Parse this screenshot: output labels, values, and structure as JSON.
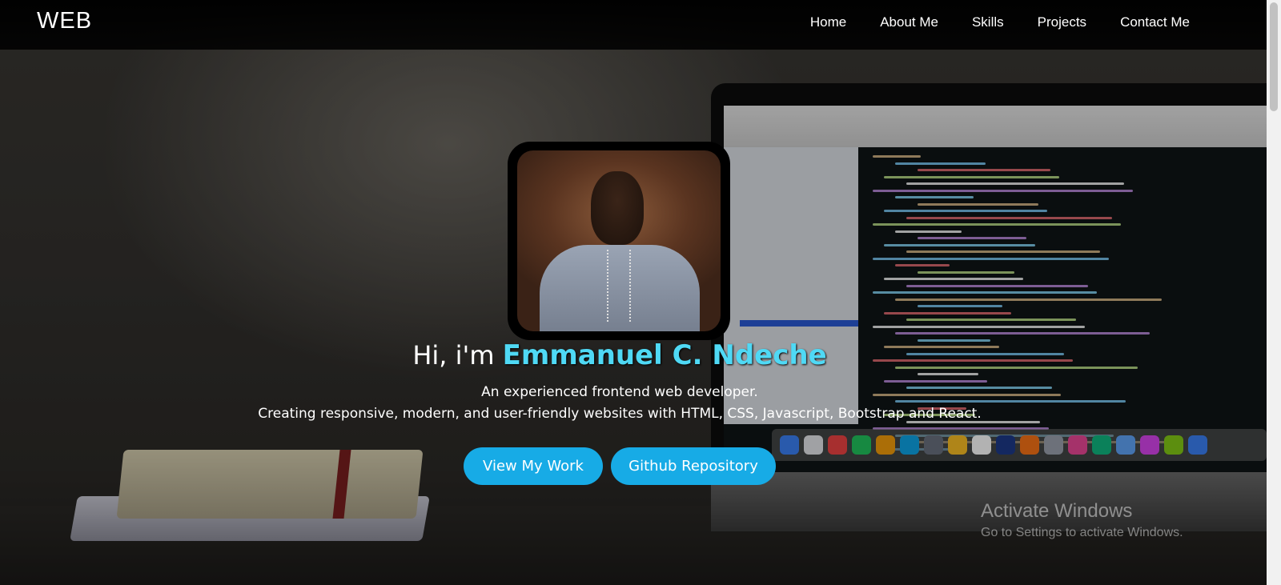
{
  "navbar": {
    "brand": "WEB",
    "links": [
      "Home",
      "About Me",
      "Skills",
      "Projects",
      "Contact Me"
    ]
  },
  "hero": {
    "greeting": "Hi, i'm",
    "name": "Emmanuel C. Ndeche",
    "tagline": "An experienced frontend web developer.",
    "description": "Creating responsive, modern, and user-friendly websites with HTML, CSS, Javascript, Bootstrap and React.",
    "primary_button": "View My Work",
    "secondary_button": "Github Repository"
  },
  "watermark": {
    "title": "Activate Windows",
    "subtitle": "Go to Settings to activate Windows."
  },
  "colors": {
    "accent": "#17abe6",
    "name_highlight": "#4fd9f5",
    "navbar_bg": "#000000"
  }
}
